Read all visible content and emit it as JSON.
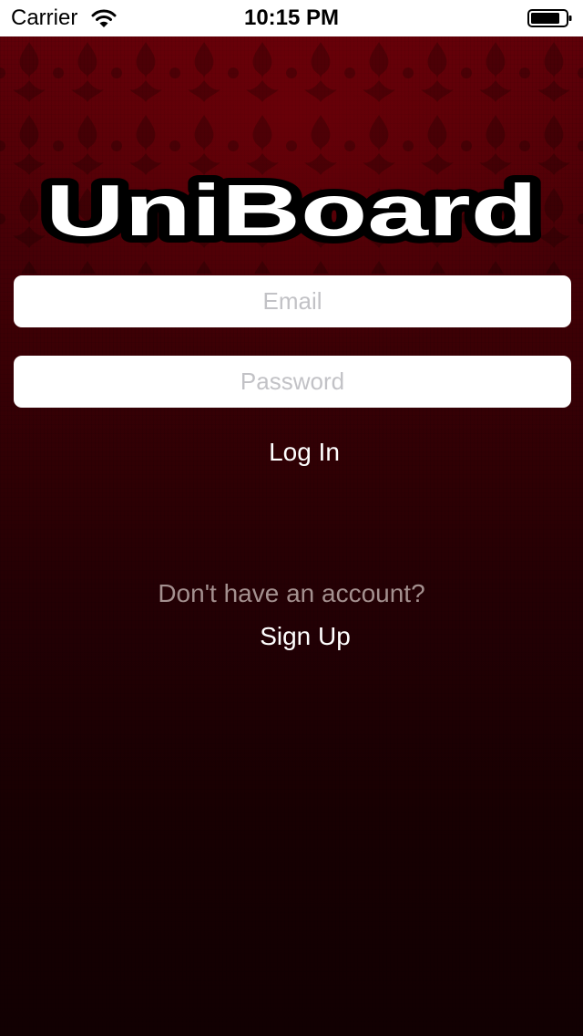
{
  "status_bar": {
    "carrier": "Carrier",
    "time": "10:15 PM",
    "wifi_icon": "wifi-icon",
    "battery_icon": "battery-icon"
  },
  "logo": {
    "text": "UniBoard"
  },
  "login_form": {
    "email_placeholder": "Email",
    "email_value": "",
    "password_placeholder": "Password",
    "password_value": "",
    "login_label": "Log In"
  },
  "signup": {
    "prompt": "Don't have an account?",
    "signup_label": "Sign Up"
  },
  "colors": {
    "background_top": "#5e0008",
    "background_bottom": "#120002",
    "field_background": "#ffffff",
    "placeholder_text": "#c2c2c6",
    "prompt_text": "#a4908f",
    "button_text": "#ffffff"
  }
}
